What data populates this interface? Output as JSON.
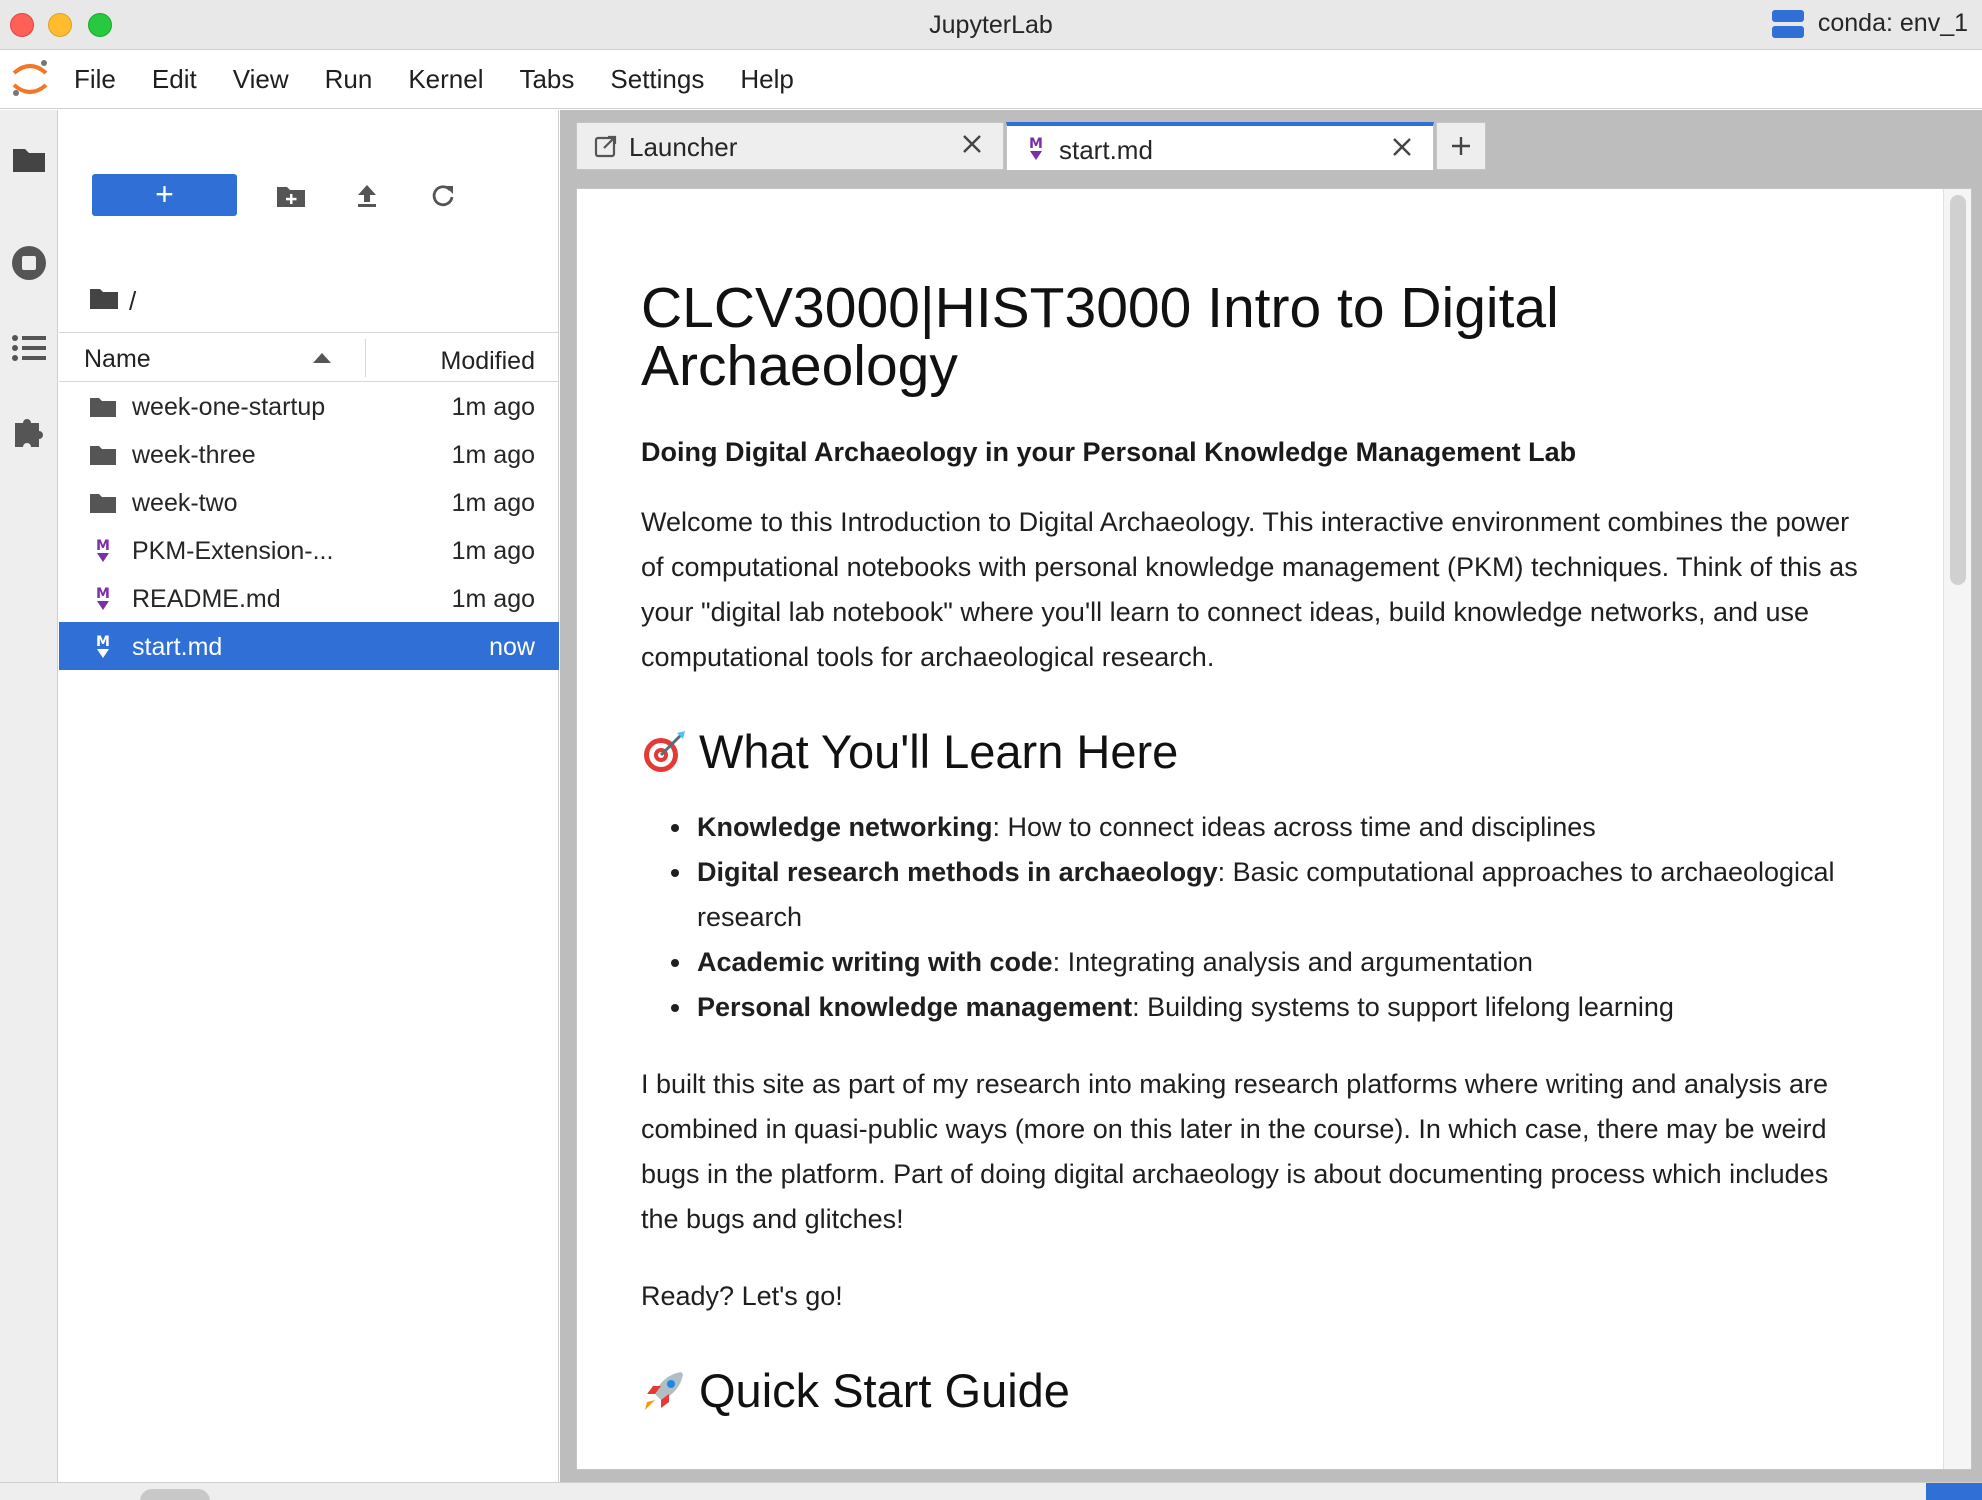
{
  "window": {
    "title": "JupyterLab",
    "kernel_env": "conda: env_1"
  },
  "menu": {
    "items": [
      "File",
      "Edit",
      "View",
      "Run",
      "Kernel",
      "Tabs",
      "Settings",
      "Help"
    ]
  },
  "activity_bar": {
    "icons": [
      "folder-icon",
      "running-icon",
      "toc-icon",
      "extension-icon"
    ]
  },
  "file_browser": {
    "new_label": "+",
    "path": "/",
    "columns": {
      "name": "Name",
      "modified": "Modified"
    },
    "files": [
      {
        "name": "week-one-startup",
        "modified": "1m ago",
        "type": "folder"
      },
      {
        "name": "week-three",
        "modified": "1m ago",
        "type": "folder"
      },
      {
        "name": "week-two",
        "modified": "1m ago",
        "type": "folder"
      },
      {
        "name": "PKM-Extension-...",
        "modified": "1m ago",
        "type": "markdown"
      },
      {
        "name": "README.md",
        "modified": "1m ago",
        "type": "markdown"
      },
      {
        "name": "start.md",
        "modified": "now",
        "type": "markdown",
        "selected": true
      }
    ]
  },
  "tabs": [
    {
      "label": "Launcher",
      "icon": "launcher-icon",
      "active": false
    },
    {
      "label": "start.md",
      "icon": "markdown-icon",
      "active": true
    }
  ],
  "document": {
    "title": "CLCV3000|HIST3000 Intro to Digital Archaeology",
    "subtitle": "Doing Digital Archaeology in your Personal Knowledge Management Lab",
    "intro": "Welcome to this Introduction to Digital Archaeology. This interactive environment combines the power of computational notebooks with personal knowledge management (PKM) techniques. Think of this as your \"digital lab notebook\" where you'll learn to connect ideas, build knowledge networks, and use computational tools for archaeological research.",
    "section1_heading": "What You'll Learn Here",
    "section1_icon": "target-icon",
    "bullets": [
      {
        "bold": "Knowledge networking",
        "text": ": How to connect ideas across time and disciplines"
      },
      {
        "bold": "Digital research methods in archaeology",
        "text": ": Basic computational approaches to archaeological research"
      },
      {
        "bold": "Academic writing with code",
        "text": ": Integrating analysis and argumentation"
      },
      {
        "bold": "Personal knowledge management",
        "text": ": Building systems to support lifelong learning"
      }
    ],
    "para2": "I built this site as part of my research into making research platforms where writing and analysis are combined in quasi-public ways (more on this later in the course). In which case, there may be weird bugs in the platform. Part of doing digital archaeology is about documenting process which includes the bugs and glitches!",
    "para3": "Ready? Let's go!",
    "section2_heading": "Quick Start Guide",
    "section2_icon": "rocket-icon"
  },
  "colors": {
    "accent": "#2f6fd6",
    "markdown_icon": "#7b2fa8",
    "jupyter_orange": "#f37726"
  }
}
